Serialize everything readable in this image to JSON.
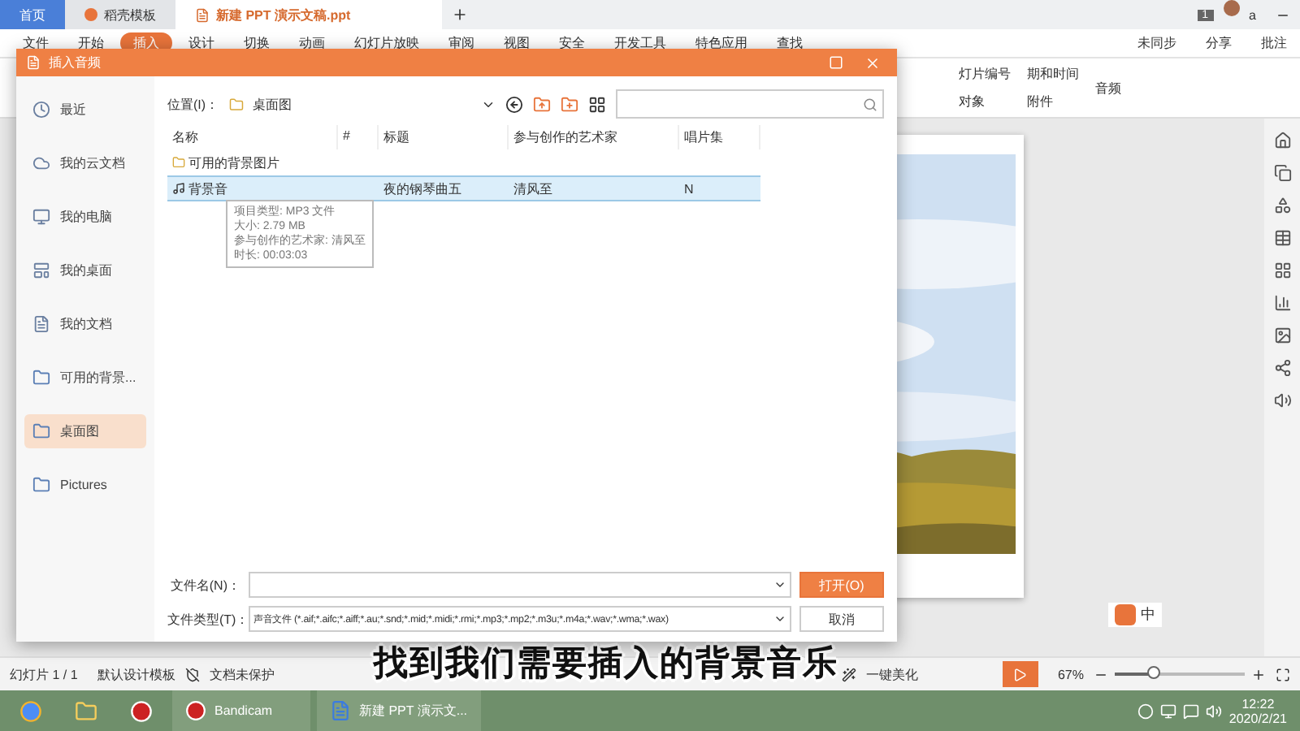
{
  "tabs": [
    {
      "label": "首页",
      "kind": "home",
      "selected": false
    },
    {
      "label": "稻壳模板",
      "kind": "store",
      "selected": false
    },
    {
      "label": "新建 PPT 演示文稿.ppt",
      "kind": "doc",
      "selected": true
    }
  ],
  "account": {
    "badge": "1",
    "user": "a"
  },
  "menu": [
    {
      "label": "文件",
      "selected": false
    },
    {
      "label": "开始",
      "selected": false
    },
    {
      "label": "插入",
      "selected": true
    },
    {
      "label": "设计",
      "selected": false
    },
    {
      "label": "切换",
      "selected": false
    },
    {
      "label": "动画",
      "selected": false
    },
    {
      "label": "幻灯片放映",
      "selected": false
    },
    {
      "label": "审阅",
      "selected": false
    },
    {
      "label": "视图",
      "selected": false
    },
    {
      "label": "安全",
      "selected": false
    },
    {
      "label": "开发工具",
      "selected": false
    },
    {
      "label": "特色应用",
      "selected": false
    },
    {
      "label": "查找",
      "selected": false
    }
  ],
  "menu_right": [
    "未同步",
    "分享",
    "批注"
  ],
  "ribbon": [
    [
      "灯片编号",
      "对象"
    ],
    [
      "期和时间",
      "附件"
    ],
    [
      "音频"
    ]
  ],
  "dialog": {
    "title": "插入音频",
    "nav": [
      {
        "label": "最近",
        "kind": "recent",
        "selected": false
      },
      {
        "label": "我的云文档",
        "kind": "cloud",
        "selected": false
      },
      {
        "label": "我的电脑",
        "kind": "computer",
        "selected": false
      },
      {
        "label": "我的桌面",
        "kind": "desktop",
        "selected": false
      },
      {
        "label": "我的文档",
        "kind": "docs",
        "selected": false
      },
      {
        "label": "可用的背景...",
        "kind": "folder",
        "selected": false
      },
      {
        "label": "桌面图",
        "kind": "folder",
        "selected": true
      },
      {
        "label": "Pictures",
        "kind": "folder",
        "selected": false
      }
    ],
    "location_label": "位置(I)：",
    "location": "桌面图",
    "columns": [
      "名称",
      "#",
      "标题",
      "参与创作的艺术家",
      "唱片集"
    ],
    "rows": [
      {
        "kind": "folder",
        "selected": false,
        "cells": [
          "可用的背景图片",
          "",
          "",
          "",
          ""
        ]
      },
      {
        "kind": "audio",
        "selected": true,
        "cells": [
          "背景音",
          "",
          "夜的钢琴曲五",
          "清风至",
          "N"
        ]
      }
    ],
    "tooltip": [
      "项目类型: MP3 文件",
      "大小: 2.79 MB",
      "参与创作的艺术家: 清风至",
      "时长: 00:03:03"
    ],
    "filename_label": "文件名(N)：",
    "filetype_label": "文件类型(T)：",
    "filetype": "声音文件 (*.aif;*.aifc;*.aiff;*.au;*.snd;*.mid;*.midi;*.rmi;*.mp3;*.mp2;*.m3u;*.m4a;*.wav;*.wma;*.wax)",
    "open_button": "打开(O)",
    "cancel_button": "取消"
  },
  "ime": "中",
  "caption": "找到我们需要插入的背景音乐",
  "status": {
    "slide": "幻灯片 1 / 1",
    "template": "默认设计模板",
    "protect": "文档未保护",
    "beautify": "一键美化",
    "zoom": "67%",
    "zoom_slider": {
      "level": 0.3
    }
  },
  "taskbar": [
    {
      "label": "Bandicam",
      "kind": "rec"
    },
    {
      "label": "新建 PPT 演示文...",
      "kind": "wps"
    }
  ],
  "clock": {
    "time": "12:22",
    "date": "2020/2/21"
  }
}
